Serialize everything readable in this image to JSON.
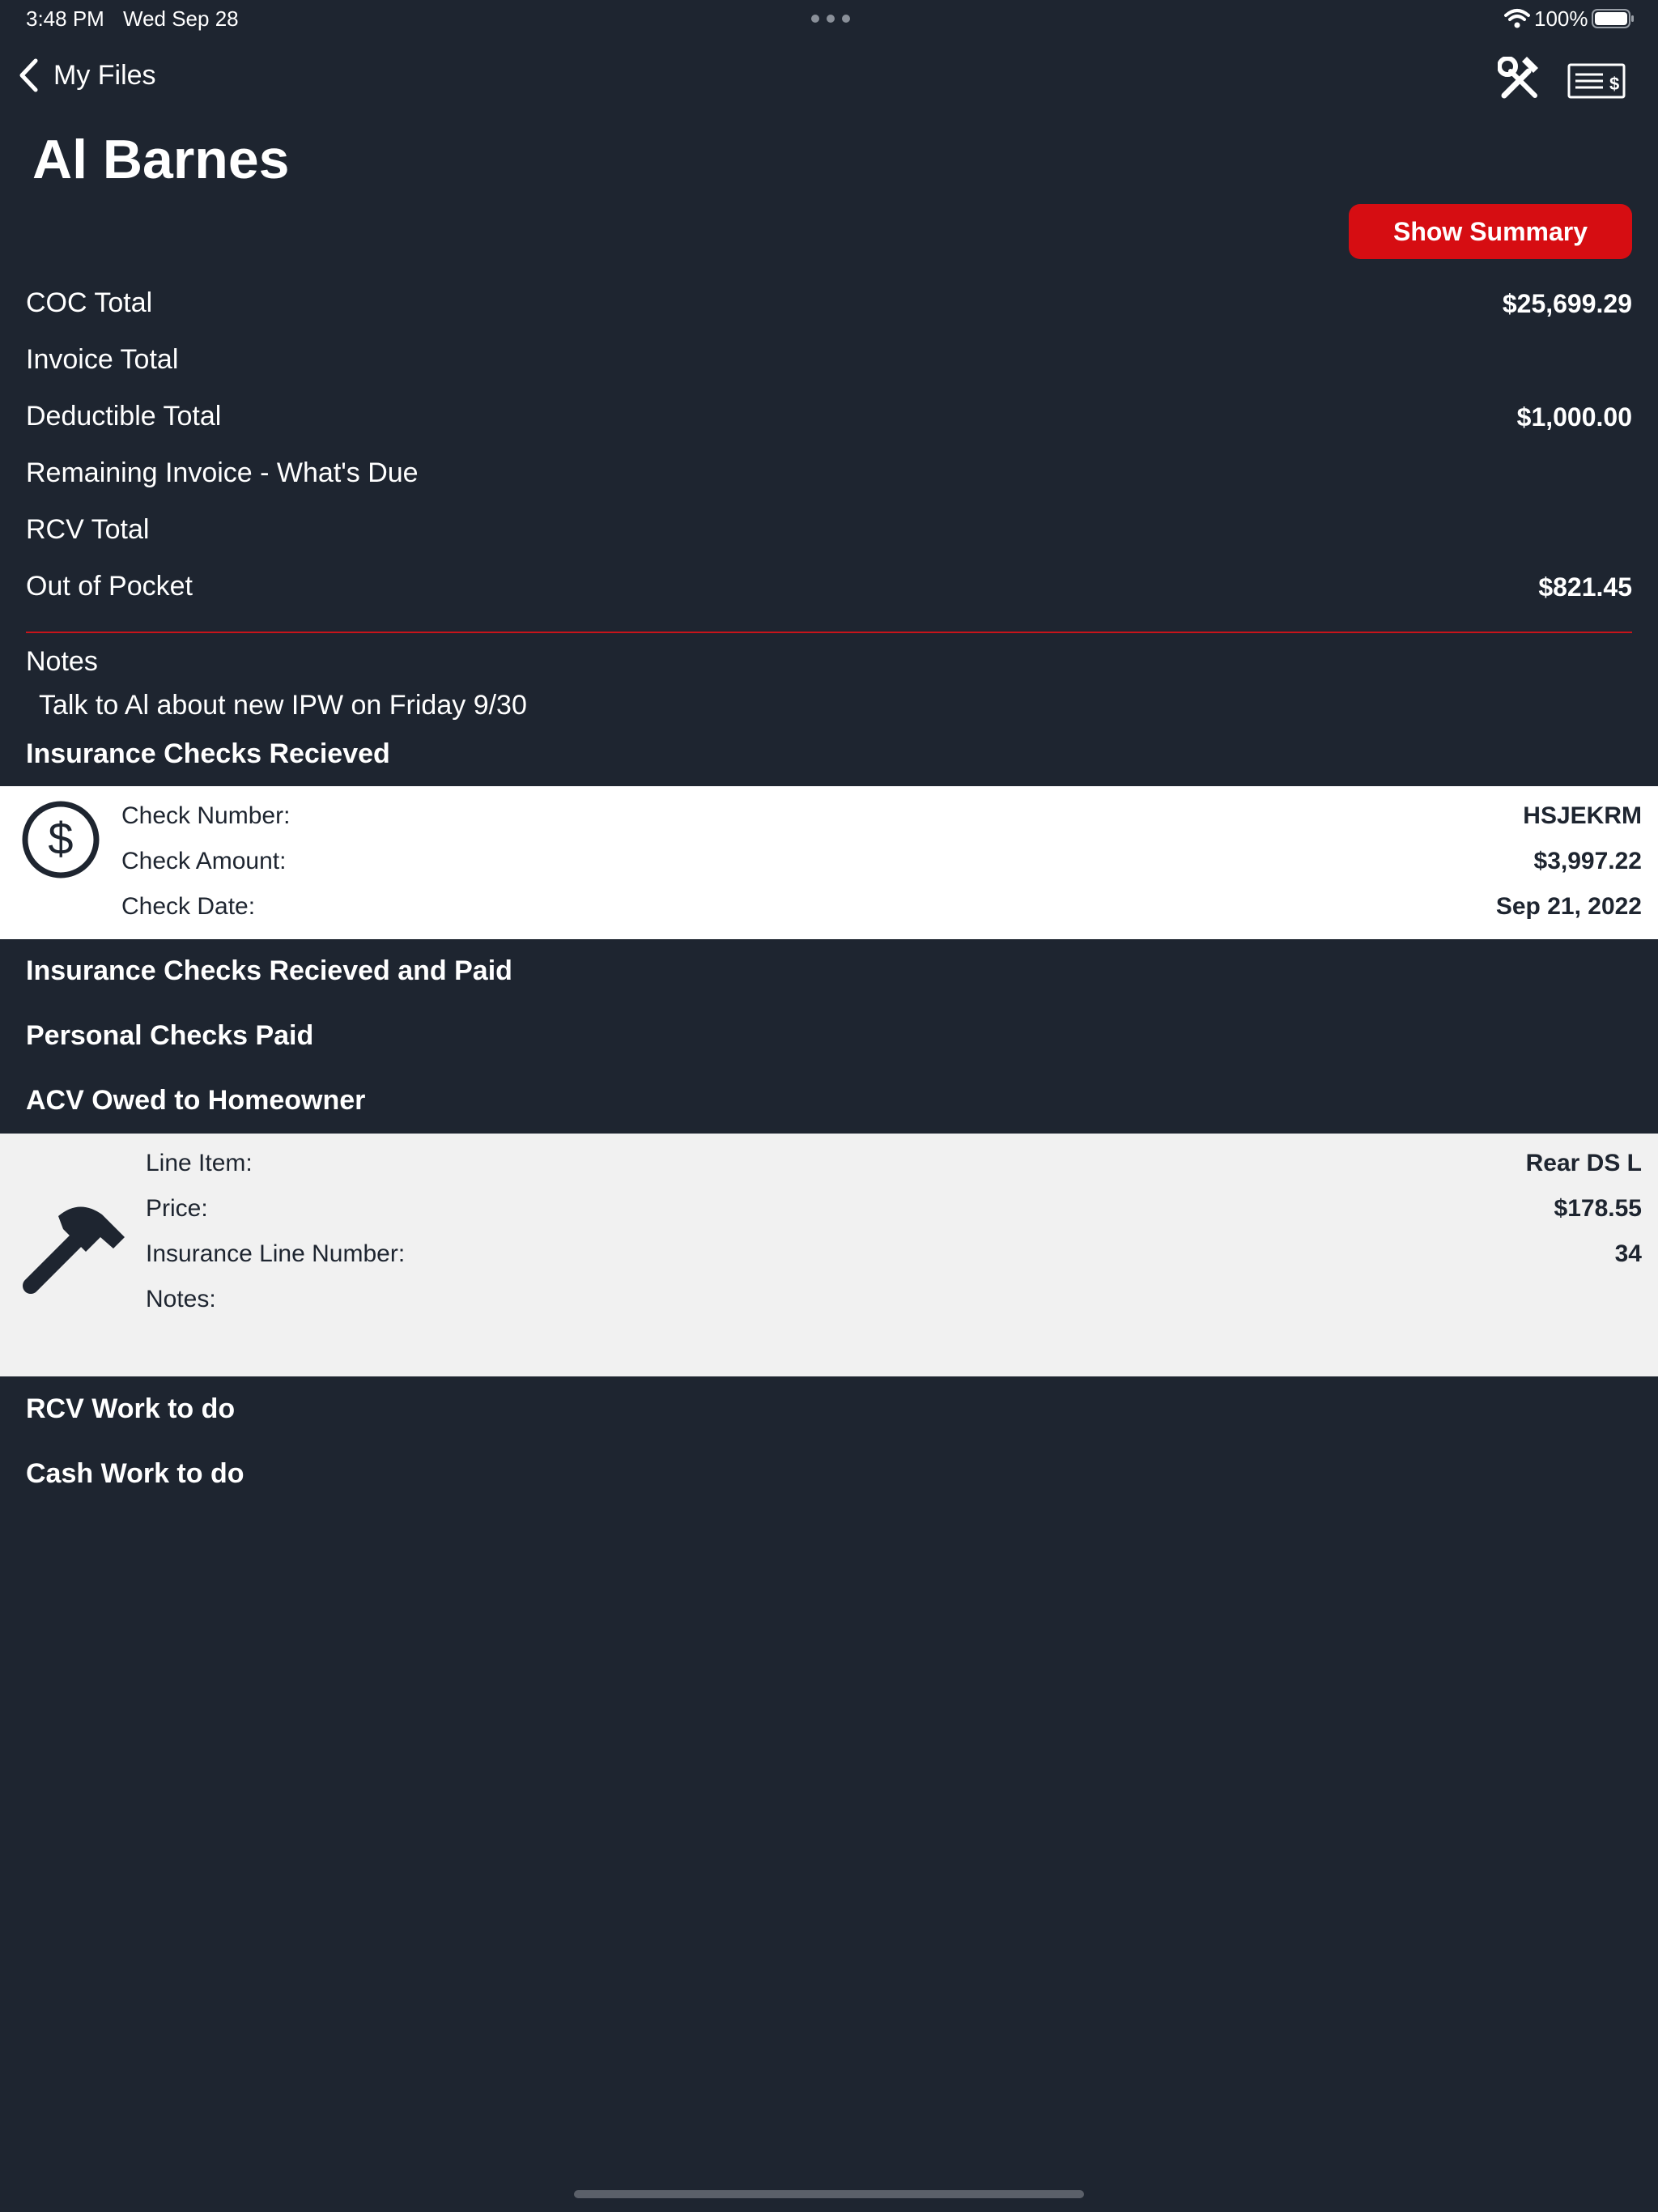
{
  "status_bar": {
    "time": "3:48 PM",
    "date": "Wed Sep 28",
    "battery": "100%"
  },
  "nav": {
    "back_label": "My Files",
    "tools_icon": "hammer-wrench-icon",
    "check_icon": "check-dollar-icon"
  },
  "page": {
    "title": "Al Barnes",
    "show_summary_label": "Show Summary"
  },
  "totals": [
    {
      "label": "COC Total",
      "value": "$25,699.29"
    },
    {
      "label": "Invoice Total",
      "value": ""
    },
    {
      "label": "Deductible Total",
      "value": "$1,000.00"
    },
    {
      "label": "Remaining Invoice - What's Due",
      "value": ""
    },
    {
      "label": "RCV Total",
      "value": ""
    },
    {
      "label": "Out of Pocket",
      "value": "$821.45"
    }
  ],
  "notes": {
    "label": "Notes",
    "text": "Talk to Al about new IPW on Friday 9/30"
  },
  "sections": {
    "insurance_checks_received": "Insurance Checks Recieved",
    "insurance_checks_received_paid": "Insurance Checks Recieved and Paid",
    "personal_checks_paid": "Personal Checks Paid",
    "acv_owed": "ACV Owed to Homeowner",
    "rcv_work": "RCV Work to do",
    "cash_work": "Cash Work to do"
  },
  "check": {
    "icon": "dollar-circle-icon",
    "number_label": "Check Number:",
    "number_value": "HSJEKRM",
    "amount_label": "Check Amount:",
    "amount_value": "$3,997.22",
    "date_label": "Check Date:",
    "date_value": "Sep 21, 2022"
  },
  "acv_item": {
    "icon": "hammer-icon",
    "line_item_label": "Line Item:",
    "line_item_value": "Rear DS L",
    "price_label": "Price:",
    "price_value": "$178.55",
    "line_number_label": "Insurance Line Number:",
    "line_number_value": "34",
    "notes_label": "Notes:"
  },
  "colors": {
    "background": "#1e2530",
    "accent_red": "#d60d12",
    "divider_red": "#c8141b",
    "panel_white": "#ffffff",
    "panel_grey": "#f1f1f1"
  }
}
